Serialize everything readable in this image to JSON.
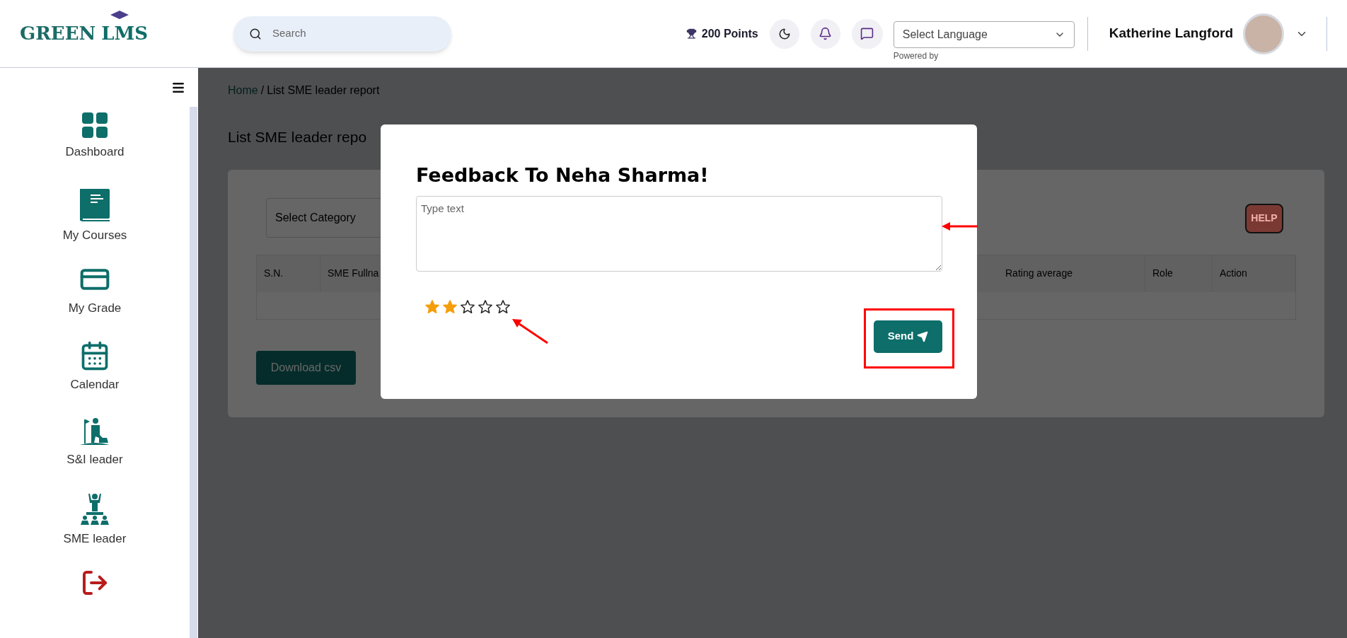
{
  "header": {
    "logo": {
      "word_1": "GREEN",
      "word_2": "LMS"
    },
    "search": {
      "placeholder": "Search"
    },
    "points": "200 Points",
    "language_select": {
      "value": "Select Language",
      "note": "Powered by"
    },
    "user": {
      "name": "Katherine Langford"
    }
  },
  "sidebar": {
    "items": [
      {
        "kind": "dashboard",
        "label": "Dashboard"
      },
      {
        "kind": "courses",
        "label": "My Courses"
      },
      {
        "kind": "grade",
        "label": "My Grade"
      },
      {
        "kind": "calendar",
        "label": "Calendar"
      },
      {
        "kind": "si_leader",
        "label": "S&I leader"
      },
      {
        "kind": "sme_leader",
        "label": "SME leader"
      },
      {
        "kind": "logout"
      }
    ]
  },
  "breadcrumb": {
    "link": "Home",
    "separator": "/",
    "current": "List SME leader report"
  },
  "page_title": "List SME leader repo",
  "category_select": {
    "value": "Select Category"
  },
  "help_badge": "HELP",
  "table": {
    "columns": [
      "S.N.",
      "SME Fullna",
      "Rating average",
      "Role",
      "Action"
    ]
  },
  "download_button": "Download csv",
  "modal": {
    "title": "Feedback To Neha Sharma!",
    "textarea": {
      "placeholder": "Type text"
    },
    "stars": 2,
    "send_button": "Send"
  }
}
